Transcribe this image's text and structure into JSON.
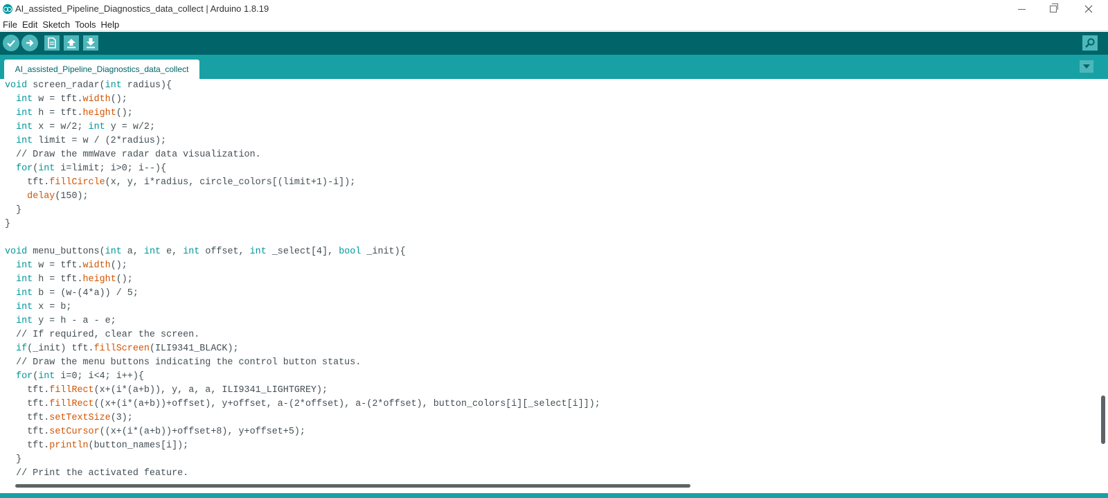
{
  "window": {
    "title": "AI_assisted_Pipeline_Diagnostics_data_collect | Arduino 1.8.19"
  },
  "menu": {
    "items": [
      "File",
      "Edit",
      "Sketch",
      "Tools",
      "Help"
    ]
  },
  "toolbar": {
    "buttons": [
      {
        "name": "Verify",
        "icon": "checkmark-icon"
      },
      {
        "name": "Upload",
        "icon": "arrow-right-icon"
      },
      {
        "name": "New",
        "icon": "new-file-icon"
      },
      {
        "name": "Open",
        "icon": "arrow-up-icon"
      },
      {
        "name": "Save",
        "icon": "arrow-down-icon"
      }
    ],
    "serial_monitor_icon": "magnifier-icon"
  },
  "tabs": [
    {
      "label": "AI_assisted_Pipeline_Diagnostics_data_collect",
      "active": true
    }
  ],
  "editor": {
    "lines": [
      [
        {
          "t": "void",
          "c": "kw"
        },
        {
          "t": " screen_radar("
        },
        {
          "t": "int",
          "c": "kw"
        },
        {
          "t": " radius){"
        }
      ],
      [
        {
          "t": "  "
        },
        {
          "t": "int",
          "c": "kw"
        },
        {
          "t": " w = tft."
        },
        {
          "t": "width",
          "c": "fn"
        },
        {
          "t": "();"
        }
      ],
      [
        {
          "t": "  "
        },
        {
          "t": "int",
          "c": "kw"
        },
        {
          "t": " h = tft."
        },
        {
          "t": "height",
          "c": "fn"
        },
        {
          "t": "();"
        }
      ],
      [
        {
          "t": "  "
        },
        {
          "t": "int",
          "c": "kw"
        },
        {
          "t": " x = w/2; "
        },
        {
          "t": "int",
          "c": "kw"
        },
        {
          "t": " y = w/2;"
        }
      ],
      [
        {
          "t": "  "
        },
        {
          "t": "int",
          "c": "kw"
        },
        {
          "t": " limit = w / (2*radius);"
        }
      ],
      [
        {
          "t": "  // Draw the mmWave radar data visualization.",
          "c": "cm"
        }
      ],
      [
        {
          "t": "  "
        },
        {
          "t": "for",
          "c": "kw"
        },
        {
          "t": "("
        },
        {
          "t": "int",
          "c": "kw"
        },
        {
          "t": " i=limit; i>0; i--){"
        }
      ],
      [
        {
          "t": "    tft."
        },
        {
          "t": "fillCircle",
          "c": "fn"
        },
        {
          "t": "(x, y, i*radius, circle_colors[(limit+1)-i]);"
        }
      ],
      [
        {
          "t": "    "
        },
        {
          "t": "delay",
          "c": "fn"
        },
        {
          "t": "(150);"
        }
      ],
      [
        {
          "t": "  }"
        }
      ],
      [
        {
          "t": "}"
        }
      ],
      [
        {
          "t": ""
        }
      ],
      [
        {
          "t": "void",
          "c": "kw"
        },
        {
          "t": " menu_buttons("
        },
        {
          "t": "int",
          "c": "kw"
        },
        {
          "t": " a, "
        },
        {
          "t": "int",
          "c": "kw"
        },
        {
          "t": " e, "
        },
        {
          "t": "int",
          "c": "kw"
        },
        {
          "t": " offset, "
        },
        {
          "t": "int",
          "c": "kw"
        },
        {
          "t": " _select[4], "
        },
        {
          "t": "bool",
          "c": "kw"
        },
        {
          "t": " _init){"
        }
      ],
      [
        {
          "t": "  "
        },
        {
          "t": "int",
          "c": "kw"
        },
        {
          "t": " w = tft."
        },
        {
          "t": "width",
          "c": "fn"
        },
        {
          "t": "();"
        }
      ],
      [
        {
          "t": "  "
        },
        {
          "t": "int",
          "c": "kw"
        },
        {
          "t": " h = tft."
        },
        {
          "t": "height",
          "c": "fn"
        },
        {
          "t": "();"
        }
      ],
      [
        {
          "t": "  "
        },
        {
          "t": "int",
          "c": "kw"
        },
        {
          "t": " b = (w-(4*a)) / 5;"
        }
      ],
      [
        {
          "t": "  "
        },
        {
          "t": "int",
          "c": "kw"
        },
        {
          "t": " x = b;"
        }
      ],
      [
        {
          "t": "  "
        },
        {
          "t": "int",
          "c": "kw"
        },
        {
          "t": " y = h - a - e;"
        }
      ],
      [
        {
          "t": "  // If required, clear the screen.",
          "c": "cm"
        }
      ],
      [
        {
          "t": "  "
        },
        {
          "t": "if",
          "c": "kw"
        },
        {
          "t": "(_init) tft."
        },
        {
          "t": "fillScreen",
          "c": "fn"
        },
        {
          "t": "(ILI9341_BLACK);"
        }
      ],
      [
        {
          "t": "  // Draw the menu buttons indicating the control button status.",
          "c": "cm"
        }
      ],
      [
        {
          "t": "  "
        },
        {
          "t": "for",
          "c": "kw"
        },
        {
          "t": "("
        },
        {
          "t": "int",
          "c": "kw"
        },
        {
          "t": " i=0; i<4; i++){"
        }
      ],
      [
        {
          "t": "    tft."
        },
        {
          "t": "fillRect",
          "c": "fn"
        },
        {
          "t": "(x+(i*(a+b)), y, a, a, ILI9341_LIGHTGREY);"
        }
      ],
      [
        {
          "t": "    tft."
        },
        {
          "t": "fillRect",
          "c": "fn"
        },
        {
          "t": "((x+(i*(a+b))+offset), y+offset, a-(2*offset), a-(2*offset), button_colors[i][_select[i]]);"
        }
      ],
      [
        {
          "t": "    tft."
        },
        {
          "t": "setTextSize",
          "c": "fn"
        },
        {
          "t": "(3);"
        }
      ],
      [
        {
          "t": "    tft."
        },
        {
          "t": "setCursor",
          "c": "fn"
        },
        {
          "t": "((x+(i*(a+b))+offset+8), y+offset+5);"
        }
      ],
      [
        {
          "t": "    tft."
        },
        {
          "t": "println",
          "c": "fn"
        },
        {
          "t": "(button_names[i]);"
        }
      ],
      [
        {
          "t": "  }"
        }
      ],
      [
        {
          "t": "  // Print the activated feature.",
          "c": "cm"
        }
      ]
    ]
  },
  "colors": {
    "toolbar": "#006468",
    "tabstrip": "#17a1a5",
    "keyword": "#00979c",
    "function": "#d35400",
    "text": "#434f54"
  }
}
